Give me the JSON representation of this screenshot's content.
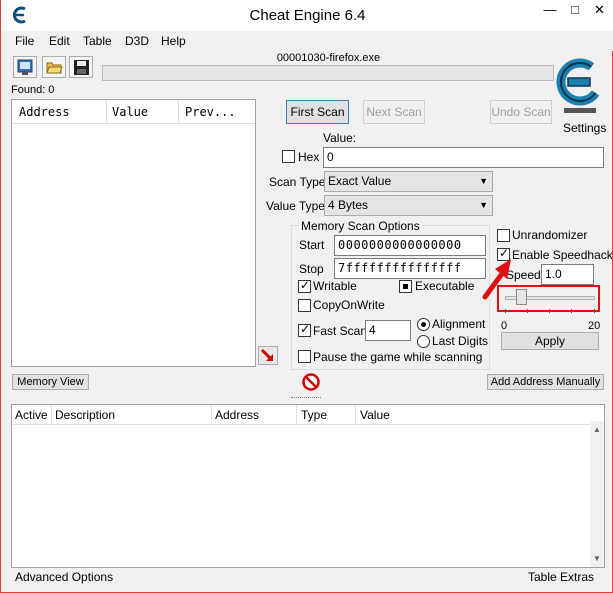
{
  "window": {
    "title": "Cheat Engine 6.4",
    "minimize_glyph": "—",
    "maximize_glyph": "□",
    "close_glyph": "✕"
  },
  "menu": {
    "items": [
      "File",
      "Edit",
      "Table",
      "D3D",
      "Help"
    ]
  },
  "toolbar": {
    "icons": [
      "open-process-icon",
      "open-file-icon",
      "save-icon"
    ]
  },
  "process": {
    "name": "00001030-firefox.exe",
    "progress_percent": 0
  },
  "found": {
    "label": "Found: 0"
  },
  "results": {
    "columns": [
      "Address",
      "Value",
      "Prev..."
    ]
  },
  "scan": {
    "first_scan": "First Scan",
    "next_scan": "Next Scan",
    "undo_scan": "Undo Scan",
    "settings": "Settings",
    "value_label": "Value:",
    "hex_label": "Hex",
    "hex_checked": false,
    "value": "0",
    "scan_type_label": "Scan Type",
    "scan_type": "Exact Value",
    "value_type_label": "Value Type",
    "value_type": "4 Bytes"
  },
  "memory_options": {
    "title": "Memory Scan Options",
    "start_label": "Start",
    "start_value": "0000000000000000",
    "stop_label": "Stop",
    "stop_value": "7fffffffffffffff",
    "writable_label": "Writable",
    "writable_checked": true,
    "executable_label": "Executable",
    "executable_state": "indeterminate",
    "copyonwrite_label": "CopyOnWrite",
    "copyonwrite_checked": false,
    "fast_scan_label": "Fast Scan",
    "fast_scan_checked": true,
    "fast_scan_value": "4",
    "alignment_label": "Alignment",
    "last_digits_label": "Last Digits",
    "alignment_selected": true,
    "pause_label": "Pause the game while scanning",
    "pause_checked": false
  },
  "speedhack": {
    "unrandomizer_label": "Unrandomizer",
    "unrandomizer_checked": false,
    "enable_label": "Enable Speedhack",
    "enable_checked": true,
    "speed_label": "Speed",
    "speed_value": "1.0",
    "slider_min": "0",
    "slider_max": "20",
    "slider_value": 1.0,
    "apply": "Apply"
  },
  "lower": {
    "memory_view": "Memory View",
    "add_address": "Add Address Manually",
    "columns": [
      "Active",
      "Description",
      "Address",
      "Type",
      "Value"
    ]
  },
  "status": {
    "advanced_options": "Advanced Options",
    "table_extras": "Table Extras"
  },
  "colors": {
    "highlight": "#e01010",
    "arrow": "#e01010"
  }
}
